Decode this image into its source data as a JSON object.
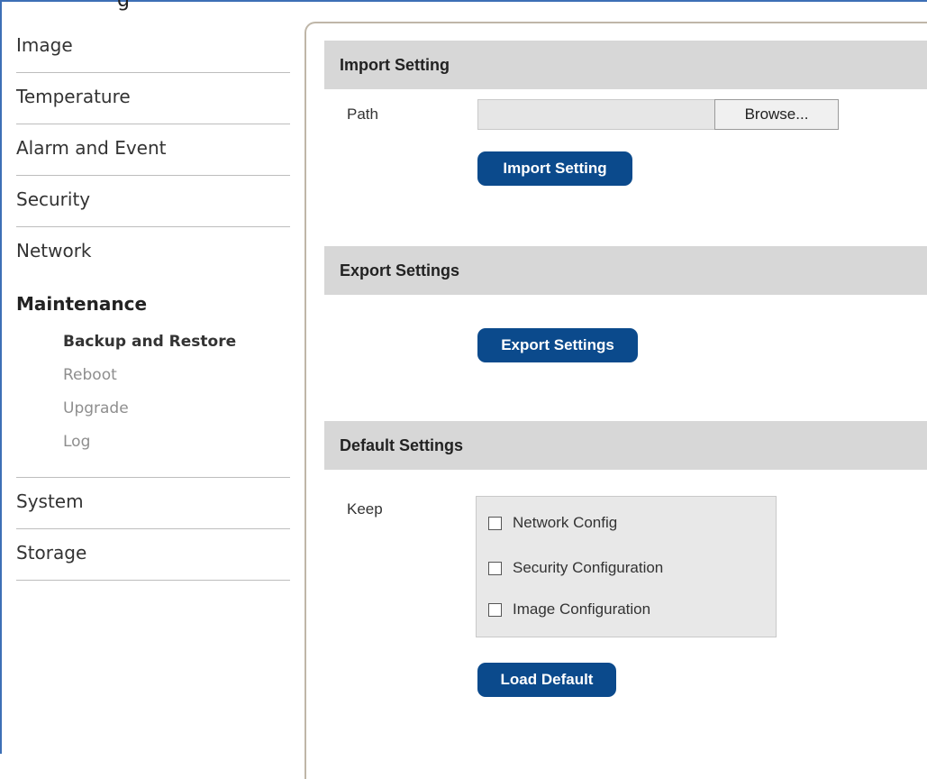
{
  "header": {
    "title_clipped": "g"
  },
  "sidebar": {
    "items_top": [
      {
        "label": "Image"
      },
      {
        "label": "Temperature"
      },
      {
        "label": "Alarm and Event"
      },
      {
        "label": "Security"
      },
      {
        "label": "Network"
      }
    ],
    "active_group": {
      "label": "Maintenance",
      "sub_items": [
        {
          "label": "Backup and Restore",
          "active": true
        },
        {
          "label": "Reboot",
          "active": false
        },
        {
          "label": "Upgrade",
          "active": false
        },
        {
          "label": "Log",
          "active": false
        }
      ]
    },
    "items_bottom": [
      {
        "label": "System"
      },
      {
        "label": "Storage"
      }
    ]
  },
  "import": {
    "title": "Import Setting",
    "path_label": "Path",
    "path_value": "",
    "browse_label": "Browse...",
    "button_label": "Import Setting"
  },
  "export": {
    "title": "Export Settings",
    "button_label": "Export Settings"
  },
  "defaults": {
    "title": "Default Settings",
    "keep_label": "Keep",
    "options": [
      {
        "label": "Network Config",
        "checked": false
      },
      {
        "label": "Security Configuration",
        "checked": false
      },
      {
        "label": "Image Configuration",
        "checked": false
      }
    ],
    "button_label": "Load Default"
  },
  "colors": {
    "primary_button": "#0b4a8c",
    "section_header_bg": "#d7d7d7",
    "frame_border": "#3d6fb6"
  }
}
